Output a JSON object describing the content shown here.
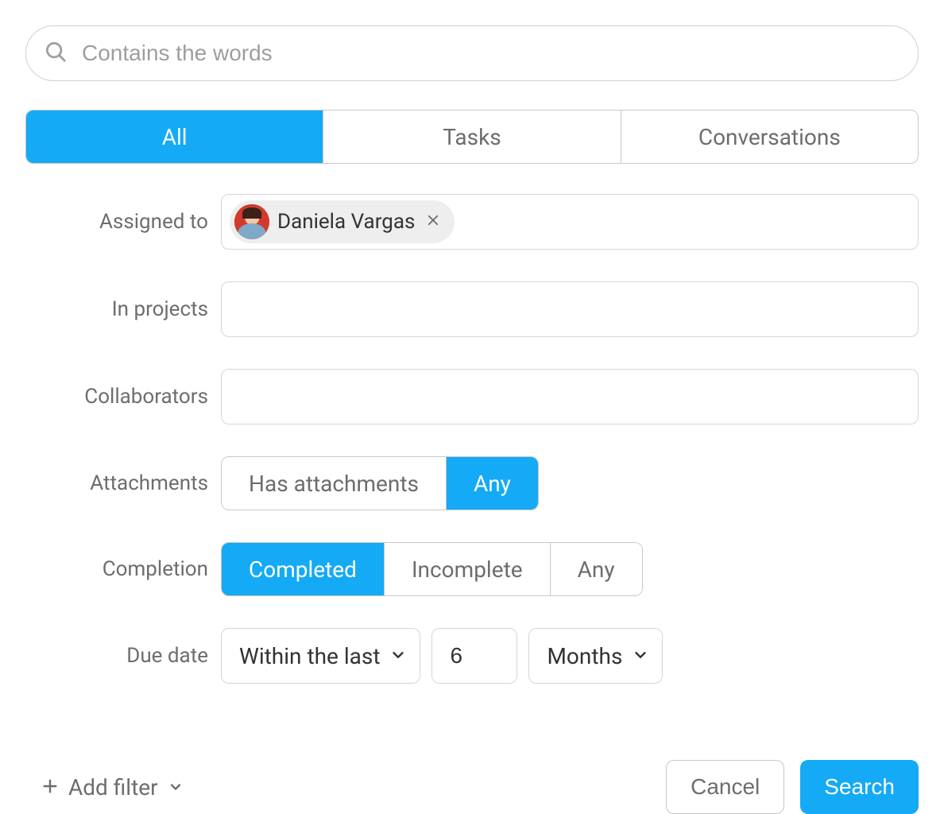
{
  "search": {
    "placeholder": "Contains the words",
    "value": ""
  },
  "tabs": {
    "all": "All",
    "tasks": "Tasks",
    "conversations": "Conversations",
    "active": "all"
  },
  "filters": {
    "assigned_to": {
      "label": "Assigned to",
      "chip_name": "Daniela Vargas"
    },
    "in_projects": {
      "label": "In projects"
    },
    "collaborators": {
      "label": "Collaborators"
    },
    "attachments": {
      "label": "Attachments",
      "options": {
        "has": "Has attachments",
        "any": "Any"
      },
      "active": "any"
    },
    "completion": {
      "label": "Completion",
      "options": {
        "completed": "Completed",
        "incomplete": "Incomplete",
        "any": "Any"
      },
      "active": "completed"
    },
    "due_date": {
      "label": "Due date",
      "range": "Within the last",
      "number": "6",
      "unit": "Months"
    }
  },
  "footer": {
    "add_filter": "Add filter",
    "cancel": "Cancel",
    "search": "Search"
  }
}
